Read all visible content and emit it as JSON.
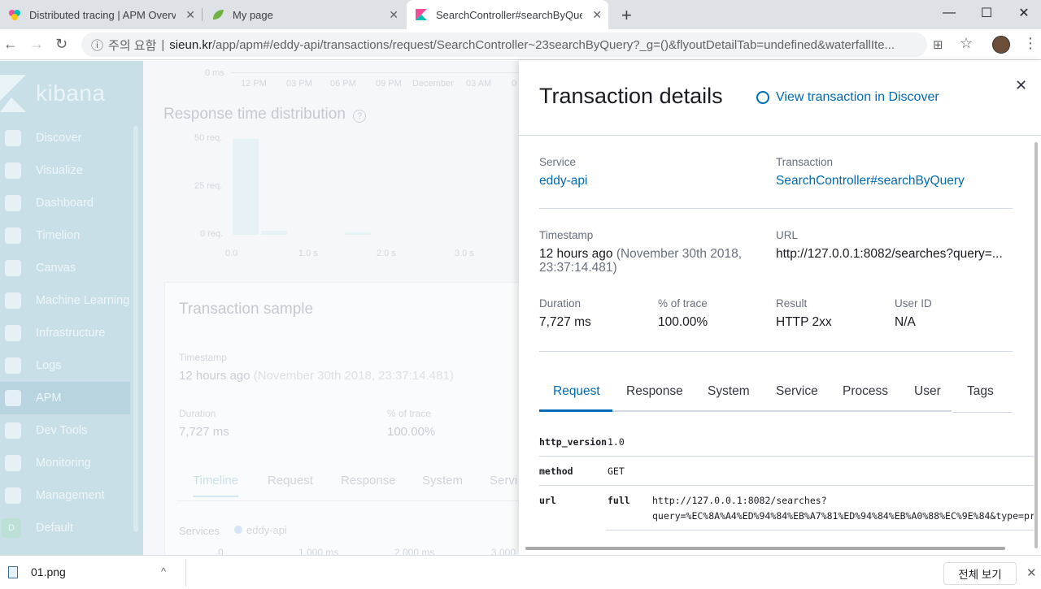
{
  "browser": {
    "tabs": [
      {
        "title": "Distributed tracing | APM Overv",
        "favicon": "kibana-multicolor-icon"
      },
      {
        "title": "My page",
        "favicon": "spring-leaf-icon"
      },
      {
        "title": "SearchController#searchByQuer",
        "favicon": "kibana-icon"
      }
    ],
    "new_tab": "+",
    "window": {
      "minimize": "—",
      "maximize": "☐",
      "close": "✕"
    },
    "nav": {
      "back": "←",
      "forward": "→",
      "reload": "↻"
    },
    "security_label": "주의 요함",
    "url_host": "sieun.kr",
    "url_path": "/app/apm#/eddy-api/transactions/request/SearchController~23searchByQuery?_g=()&flyoutDetailTab=undefined&waterfallIte...",
    "icons": {
      "info": "ⓘ",
      "translate": "⊞",
      "star": "☆",
      "menu": "⋮"
    }
  },
  "kibana": {
    "brand": "kibana",
    "nav": [
      "Discover",
      "Visualize",
      "Dashboard",
      "Timelion",
      "Canvas",
      "Machine Learning",
      "Infrastructure",
      "Logs",
      "APM",
      "Dev Tools",
      "Monitoring",
      "Management",
      "Default"
    ],
    "default_badge": "D",
    "active": "APM"
  },
  "main": {
    "top_axis": {
      "y_label": "0 ms",
      "x_ticks": [
        "12 PM",
        "03 PM",
        "06 PM",
        "09 PM",
        "December",
        "03 AM",
        "0"
      ]
    },
    "distribution": {
      "title": "Response time distribution",
      "help": "?",
      "y_ticks": [
        "50 req.",
        "25 req.",
        "0 req."
      ],
      "x_ticks": [
        "0.0",
        "1.0 s",
        "2.0 s",
        "3.0 s"
      ]
    },
    "sample": {
      "title": "Transaction sample",
      "timestamp_label": "Timestamp",
      "timestamp_value": "12 hours ago",
      "timestamp_abs": "(November 30th 2018, 23:37:14.481)",
      "duration_label": "Duration",
      "duration_value": "7,727 ms",
      "trace_label": "% of trace",
      "trace_value": "100.00%",
      "tabs": [
        "Timeline",
        "Request",
        "Response",
        "System",
        "Servi"
      ],
      "services_label": "Services",
      "services_legend": "eddy-api",
      "axis_ticks": [
        "0",
        "1,000 ms",
        "2,000 ms",
        "3,000"
      ]
    }
  },
  "flyout": {
    "title": "Transaction details",
    "discover_link": "View transaction in Discover",
    "close": "✕",
    "service_label": "Service",
    "service_value": "eddy-api",
    "transaction_label": "Transaction",
    "transaction_value": "SearchController#searchByQuery",
    "timestamp_label": "Timestamp",
    "timestamp_value": "12 hours ago",
    "timestamp_abs": "(November 30th 2018,",
    "timestamp_abs2": "23:37:14.481)",
    "url_label": "URL",
    "url_value": "http://127.0.0.1:8082/searches?query=...",
    "duration_label": "Duration",
    "duration_value": "7,727 ms",
    "trace_label": "% of trace",
    "trace_value": "100.00%",
    "result_label": "Result",
    "result_value": "HTTP 2xx",
    "user_label": "User ID",
    "user_value": "N/A",
    "tabs": [
      "Request",
      "Response",
      "System",
      "Service",
      "Process",
      "User",
      "Tags"
    ],
    "request": {
      "http_version_key": "http_version",
      "http_version_val": "1.0",
      "method_key": "method",
      "method_val": "GET",
      "url_key": "url",
      "url_sub_key": "full",
      "url_line1": "http://127.0.0.1:8082/searches?",
      "url_line2": "query=%EC%8A%A4%ED%94%84%EB%A7%81%ED%94%84%EB%A0%88%EC%9E%84&type=pr"
    }
  },
  "downloads": {
    "file": "01.png",
    "chevron": "^",
    "show_all": "전체 보기",
    "close": "✕"
  }
}
